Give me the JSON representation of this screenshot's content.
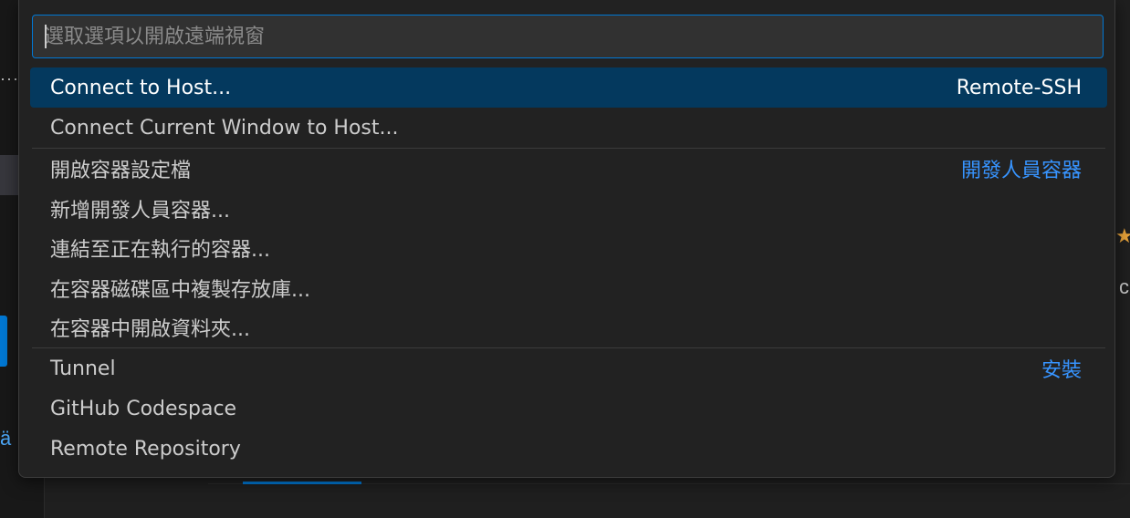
{
  "quick_pick": {
    "placeholder": "選取選項以開啟遠端視窗",
    "value": "",
    "groups": [
      {
        "items": [
          {
            "label": "Connect to Host...",
            "detail": "Remote-SSH",
            "selected": true
          },
          {
            "label": "Connect Current Window to Host...",
            "detail": ""
          }
        ]
      },
      {
        "items": [
          {
            "label": "開啟容器設定檔",
            "detail": "開發人員容器",
            "detail_link": true
          },
          {
            "label": "新增開發人員容器...",
            "detail": ""
          },
          {
            "label": "連結至正在執行的容器...",
            "detail": ""
          },
          {
            "label": "在容器磁碟區中複製存放庫...",
            "detail": ""
          },
          {
            "label": "在容器中開啟資料夾...",
            "detail": ""
          }
        ]
      },
      {
        "items": [
          {
            "label": "Tunnel",
            "detail": "安裝",
            "detail_link": true
          },
          {
            "label": "GitHub Codespace",
            "detail": ""
          },
          {
            "label": "Remote Repository",
            "detail": ""
          }
        ]
      }
    ]
  },
  "background": {
    "left_dots": "···",
    "left_glyph": "ä",
    "right_star_icon": "star-icon",
    "right_text": "c",
    "colors": {
      "accent": "#0078d4",
      "selection": "#04395e",
      "link": "#3794ff"
    }
  }
}
